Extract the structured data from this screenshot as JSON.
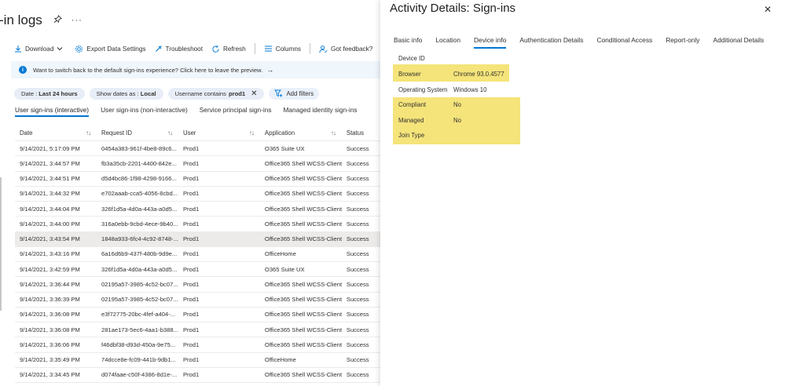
{
  "left": {
    "page_title": "-in logs",
    "toolbar": {
      "download": "Download",
      "export": "Export Data Settings",
      "troubleshoot": "Troubleshoot",
      "refresh": "Refresh",
      "columns": "Columns",
      "feedback": "Got feedback?"
    },
    "info_bar": {
      "text": "Want to switch back to the default sign-ins experience? Click here to leave the preview."
    },
    "filters": {
      "date_label": "Date :",
      "date_value": "Last 24 hours",
      "show_dates_label": "Show dates as :",
      "show_dates_value": "Local",
      "username_label": "Username contains",
      "username_value": "prod1",
      "add_filters": "Add filters"
    },
    "subtabs": [
      {
        "label": "User sign-ins (interactive)"
      },
      {
        "label": "User sign-ins (non-interactive)"
      },
      {
        "label": "Service principal sign-ins"
      },
      {
        "label": "Managed identity sign-ins"
      }
    ],
    "table": {
      "headers": {
        "date": "Date",
        "request_id": "Request ID",
        "user": "User",
        "application": "Application",
        "status": "Status"
      },
      "rows": [
        {
          "date": "9/14/2021, 5:17:09 PM",
          "request_id": "0454a383-961f-4be8-89c6...",
          "user": "Prod1",
          "application": "O365 Suite UX",
          "status": "Success"
        },
        {
          "date": "9/14/2021, 3:44:57 PM",
          "request_id": "fb3a35cb-2201-4400-842e...",
          "user": "Prod1",
          "application": "Office365 Shell WCSS-Client",
          "status": "Success"
        },
        {
          "date": "9/14/2021, 3:44:51 PM",
          "request_id": "d5d4bc86-1f98-4298-9166...",
          "user": "Prod1",
          "application": "Office365 Shell WCSS-Client",
          "status": "Success"
        },
        {
          "date": "9/14/2021, 3:44:32 PM",
          "request_id": "e702aaab-cca5-4056-8cbd...",
          "user": "Prod1",
          "application": "Office365 Shell WCSS-Client",
          "status": "Success"
        },
        {
          "date": "9/14/2021, 3:44:04 PM",
          "request_id": "326f1d5a-4d0a-443a-a0d5...",
          "user": "Prod1",
          "application": "Office365 Shell WCSS-Client",
          "status": "Success"
        },
        {
          "date": "9/14/2021, 3:44:00 PM",
          "request_id": "316a0ebb-9cbd-4ece-9b40...",
          "user": "Prod1",
          "application": "Office365 Shell WCSS-Client",
          "status": "Success"
        },
        {
          "date": "9/14/2021, 3:43:54 PM",
          "request_id": "1848a933-6fc4-4c92-8748-...",
          "user": "Prod1",
          "application": "Office365 Shell WCSS-Client",
          "status": "Success"
        },
        {
          "date": "9/14/2021, 3:43:16 PM",
          "request_id": "6a16d6b9-437f-480b-9d9e...",
          "user": "Prod1",
          "application": "OfficeHome",
          "status": "Success"
        },
        {
          "date": "9/14/2021, 3:42:59 PM",
          "request_id": "326f1d5a-4d0a-443a-a0d5...",
          "user": "Prod1",
          "application": "O365 Suite UX",
          "status": "Success"
        },
        {
          "date": "9/14/2021, 3:36:44 PM",
          "request_id": "02195a57-3985-4c52-bc07...",
          "user": "Prod1",
          "application": "Office365 Shell WCSS-Client",
          "status": "Success"
        },
        {
          "date": "9/14/2021, 3:36:39 PM",
          "request_id": "02195a57-3985-4c52-bc07...",
          "user": "Prod1",
          "application": "Office365 Shell WCSS-Client",
          "status": "Success"
        },
        {
          "date": "9/14/2021, 3:36:08 PM",
          "request_id": "e3f72775-20bc-4fef-a404-...",
          "user": "Prod1",
          "application": "Office365 Shell WCSS-Client",
          "status": "Success"
        },
        {
          "date": "9/14/2021, 3:36:08 PM",
          "request_id": "281ae173-5ec6-4aa1-b388...",
          "user": "Prod1",
          "application": "Office365 Shell WCSS-Client",
          "status": "Success"
        },
        {
          "date": "9/14/2021, 3:36:06 PM",
          "request_id": "f46dbf38-d93d-450a-9e75...",
          "user": "Prod1",
          "application": "Office365 Shell WCSS-Client",
          "status": "Success"
        },
        {
          "date": "9/14/2021, 3:35:49 PM",
          "request_id": "74dcce8e-fc09-441b-9db1...",
          "user": "Prod1",
          "application": "OfficeHome",
          "status": "Success"
        },
        {
          "date": "9/14/2021, 3:34:45 PM",
          "request_id": "d074faae-c50f-4386-8d1e-...",
          "user": "Prod1",
          "application": "Office365 Shell WCSS-Client",
          "status": "Success"
        }
      ]
    }
  },
  "panel": {
    "title": "Activity Details: Sign-ins",
    "tabs": [
      {
        "label": "Basic info"
      },
      {
        "label": "Location"
      },
      {
        "label": "Device info"
      },
      {
        "label": "Authentication Details"
      },
      {
        "label": "Conditional Access"
      },
      {
        "label": "Report-only"
      },
      {
        "label": "Additional Details"
      }
    ],
    "device_info": [
      {
        "key": "Device ID",
        "value": ""
      },
      {
        "key": "Browser",
        "value": "Chrome 93.0.4577"
      },
      {
        "key": "Operating System",
        "value": "Windows 10"
      },
      {
        "key": "Compliant",
        "value": "No"
      },
      {
        "key": "Managed",
        "value": "No"
      },
      {
        "key": "Join Type",
        "value": ""
      }
    ]
  },
  "colors": {
    "accent": "#0078d4",
    "highlight": "#f5e47a",
    "info_bar_bg": "#eff6fc",
    "selected_row": "#edebe9"
  },
  "selected_row_index": 6,
  "active_subtab_index": 0,
  "active_panel_tab_index": 2
}
